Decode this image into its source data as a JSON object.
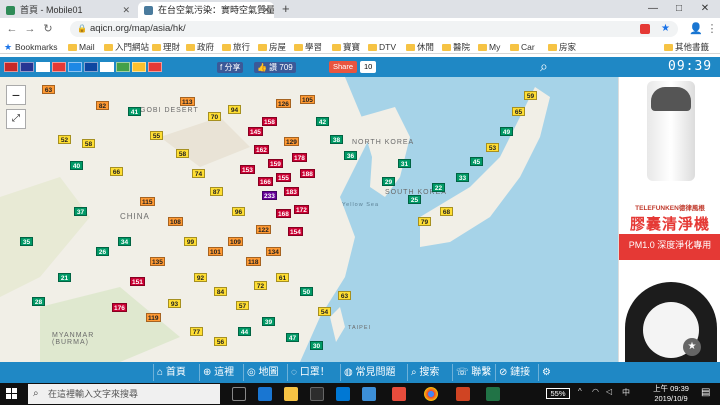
{
  "browser": {
    "tabs": [
      {
        "title": "首頁 - Mobile01",
        "favicon_color": "#2e8b57",
        "active": false
      },
      {
        "title": "在台空氣污染：實時空氣質量指數",
        "favicon_color": "#4a7b9d",
        "active": true
      }
    ],
    "new_tab": "+",
    "window_controls": [
      "—",
      "□",
      "✕"
    ],
    "url": "aqicn.org/map/asia/hk/",
    "bookmarks": [
      "Bookmarks",
      "Mail",
      "入門網站",
      "理財",
      "政府",
      "旅行",
      "房屋",
      "學習",
      "寶寶",
      "DTV",
      "休閒",
      "醫院",
      "My",
      "Car",
      "房家",
      "其他書籤"
    ]
  },
  "site_header": {
    "flags": [
      "#c62828",
      "#283593",
      "#ffffff",
      "#e53935",
      "#1e88e5",
      "#0d47a1",
      "#ffffff",
      "#43a047",
      "#fbc02d",
      "#e53935"
    ],
    "facebook_share": "f 分享",
    "facebook_like": "👍 讚 709",
    "share_label": "Share",
    "share_count": "10",
    "time": "09:39"
  },
  "map": {
    "zoom_in": "+",
    "zoom_out": "−",
    "fullscreen": "⤢",
    "labels": [
      "GOBI DESERT",
      "NORTH KOREA",
      "SOUTH KOREA",
      "CHINA",
      "Yellow Sea",
      "MYANMAR (BURMA)",
      "TAIPEI"
    ],
    "colors": {
      "good": "#009966",
      "moderate": "#ffde33",
      "sensitive": "#ff9933",
      "unhealthy": "#cc0033",
      "very_unhealthy": "#660099"
    },
    "markers": [
      [
        "63",
        "sensitive"
      ],
      [
        "82",
        "sensitive"
      ],
      [
        "41",
        "good"
      ],
      [
        "113",
        "sensitive"
      ],
      [
        "70",
        "moderate"
      ],
      [
        "94",
        "moderate"
      ],
      [
        "145",
        "unhealthy"
      ],
      [
        "158",
        "unhealthy"
      ],
      [
        "126",
        "sensitive"
      ],
      [
        "105",
        "sensitive"
      ],
      [
        "162",
        "unhealthy"
      ],
      [
        "129",
        "sensitive"
      ],
      [
        "159",
        "unhealthy"
      ],
      [
        "178",
        "unhealthy"
      ],
      [
        "153",
        "unhealthy"
      ],
      [
        "166",
        "unhealthy"
      ],
      [
        "155",
        "unhealthy"
      ],
      [
        "233",
        "very_unhealthy"
      ],
      [
        "183",
        "unhealthy"
      ],
      [
        "188",
        "unhealthy"
      ],
      [
        "168",
        "unhealthy"
      ],
      [
        "172",
        "unhealthy"
      ],
      [
        "154",
        "unhealthy"
      ],
      [
        "122",
        "sensitive"
      ],
      [
        "96",
        "moderate"
      ],
      [
        "87",
        "moderate"
      ],
      [
        "74",
        "moderate"
      ],
      [
        "58",
        "moderate"
      ],
      [
        "55",
        "moderate"
      ],
      [
        "42",
        "good"
      ],
      [
        "38",
        "good"
      ],
      [
        "36",
        "good"
      ],
      [
        "31",
        "good"
      ],
      [
        "29",
        "good"
      ],
      [
        "25",
        "good"
      ],
      [
        "22",
        "good"
      ],
      [
        "33",
        "good"
      ],
      [
        "45",
        "good"
      ],
      [
        "53",
        "moderate"
      ],
      [
        "49",
        "good"
      ],
      [
        "65",
        "moderate"
      ],
      [
        "59",
        "moderate"
      ],
      [
        "68",
        "moderate"
      ],
      [
        "79",
        "moderate"
      ],
      [
        "101",
        "sensitive"
      ],
      [
        "109",
        "sensitive"
      ],
      [
        "118",
        "sensitive"
      ],
      [
        "134",
        "sensitive"
      ],
      [
        "92",
        "moderate"
      ],
      [
        "84",
        "moderate"
      ],
      [
        "57",
        "moderate"
      ],
      [
        "72",
        "moderate"
      ],
      [
        "61",
        "moderate"
      ],
      [
        "50",
        "good"
      ],
      [
        "54",
        "moderate"
      ],
      [
        "63",
        "moderate"
      ],
      [
        "34",
        "good"
      ],
      [
        "26",
        "good"
      ],
      [
        "40",
        "good"
      ],
      [
        "115",
        "sensitive"
      ],
      [
        "108",
        "sensitive"
      ],
      [
        "99",
        "moderate"
      ],
      [
        "135",
        "sensitive"
      ],
      [
        "151",
        "unhealthy"
      ],
      [
        "176",
        "unhealthy"
      ],
      [
        "119",
        "sensitive"
      ],
      [
        "93",
        "moderate"
      ],
      [
        "77",
        "moderate"
      ],
      [
        "56",
        "moderate"
      ],
      [
        "44",
        "good"
      ],
      [
        "39",
        "good"
      ],
      [
        "47",
        "good"
      ],
      [
        "30",
        "good"
      ],
      [
        "21",
        "good"
      ],
      [
        "28",
        "good"
      ],
      [
        "35",
        "good"
      ],
      [
        "37",
        "good"
      ],
      [
        "52",
        "moderate"
      ],
      [
        "58",
        "moderate"
      ],
      [
        "66",
        "moderate"
      ]
    ]
  },
  "ad": {
    "brand": "TELEFUNKEN德律風根",
    "title": "膠囊清淨機",
    "subtitle": "PM1.0 深度淨化專用",
    "star": "★"
  },
  "bottom_nav": [
    "首頁",
    "這裡",
    "地圖",
    "口罩！",
    "常見問題",
    "搜索",
    "聯繫",
    "鏈接",
    "⚙"
  ],
  "taskbar": {
    "search_placeholder": "在這裡輸入文字來搜尋",
    "battery": "55%",
    "time": "上午 09:39",
    "date": "2019/10/9",
    "tray_lang": "中"
  }
}
